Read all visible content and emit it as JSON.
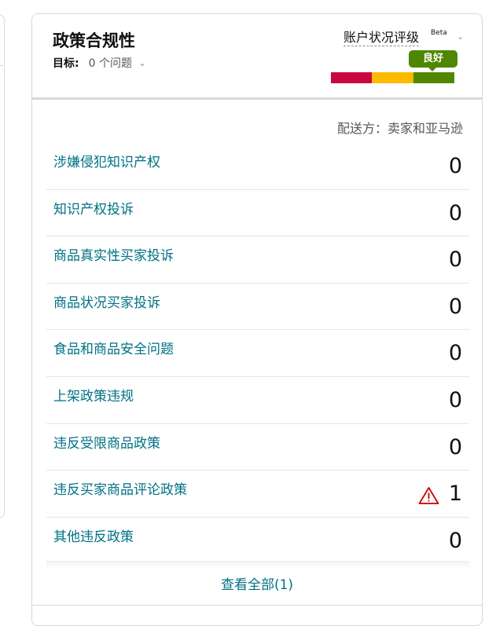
{
  "card": {
    "title": "政策合规性",
    "target_label": "目标:",
    "target_value": "0 个问题",
    "rating_label": "账户状况评级",
    "beta": "Beta",
    "rating_status": "良好",
    "delivered_by": "配送方：卖家和亚马逊",
    "view_all": "查看全部(1)"
  },
  "health_colors": {
    "red": "#c7073d",
    "yellow": "#fcba00",
    "green": "#4f8700"
  },
  "rows": [
    {
      "label": "涉嫌侵犯知识产权",
      "value": "0"
    },
    {
      "label": "知识产权投诉",
      "value": "0"
    },
    {
      "label": "商品真实性买家投诉",
      "value": "0"
    },
    {
      "label": "商品状况买家投诉",
      "value": "0"
    },
    {
      "label": "食品和商品安全问题",
      "value": "0"
    },
    {
      "label": "上架政策违规",
      "value": "0"
    },
    {
      "label": "违反受限商品政策",
      "value": "0"
    },
    {
      "label": "违反买家商品评论政策",
      "value": "1",
      "icon": "warning-icon"
    },
    {
      "label": "其他违反政策",
      "value": "0"
    }
  ]
}
